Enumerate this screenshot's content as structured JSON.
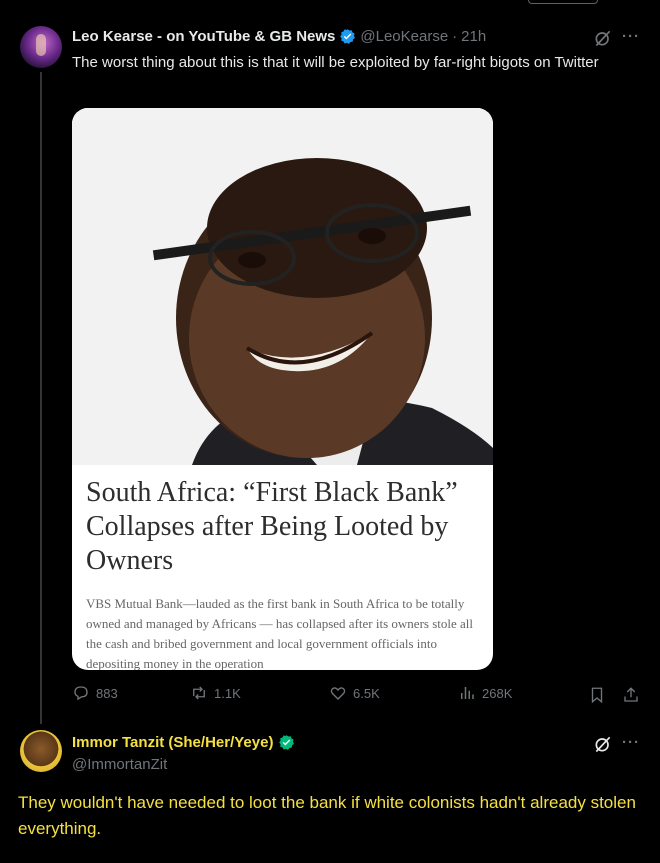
{
  "tweet1": {
    "author_name": "Leo Kearse - on YouTube & GB News",
    "handle": "@LeoKearse",
    "separator": "·",
    "time": "21h",
    "more": "···",
    "text": "The worst thing about this is that it will be exploited by far-right bigots on Twitter",
    "card": {
      "title": "South Africa: “First Black Bank” Collapses after Being Looted by Owners",
      "body": "VBS Mutual Bank—lauded as the first bank in South Africa to be totally owned and managed by Africans — has collapsed after its owners stole all the cash and bribed government and local government officials into depositing money in the operation"
    },
    "metrics": {
      "replies": "883",
      "reposts": "1.1K",
      "likes": "6.5K",
      "views": "268K"
    }
  },
  "tweet2": {
    "author_name": "Immor Tanzit (She/Her/Yeye)",
    "handle": "@ImmortanZit",
    "more": "···",
    "text": "They wouldn't have needed to loot the bank if white colonists hadn't already stolen everything."
  },
  "colors": {
    "background": "#000000",
    "text_primary": "#e7e9ea",
    "text_secondary": "#71767b",
    "verified_blue": "#1d9bf0",
    "verified_green": "#00ba7c",
    "highlight_yellow": "#f4e043"
  },
  "icons": [
    "verified-badge-icon",
    "grok-icon",
    "more-icon",
    "reply-icon",
    "repost-icon",
    "like-icon",
    "views-icon",
    "bookmark-icon",
    "share-icon"
  ]
}
